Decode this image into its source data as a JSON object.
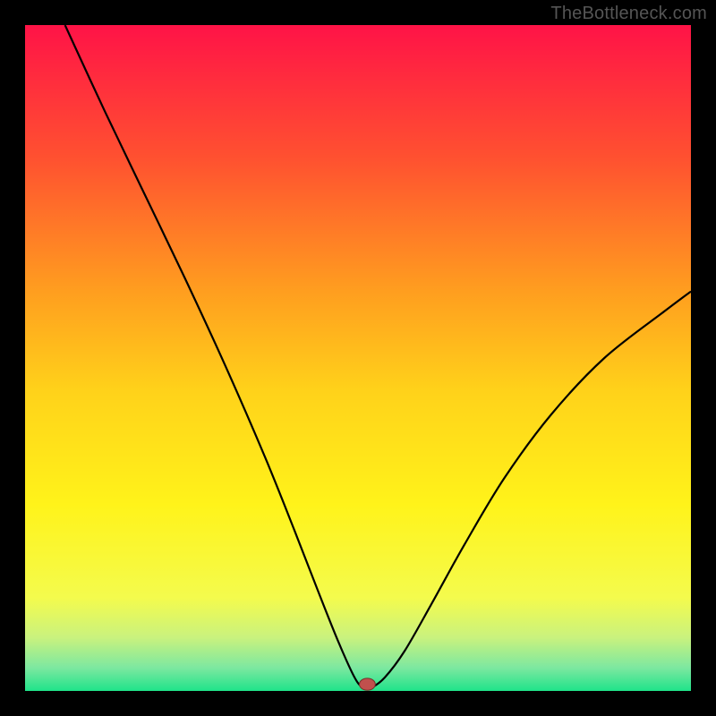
{
  "watermark": "TheBottleneck.com",
  "chart_data": {
    "type": "line",
    "title": "",
    "xlabel": "",
    "ylabel": "",
    "xlim": [
      0,
      1
    ],
    "ylim": [
      0,
      1
    ],
    "background_gradient": {
      "orientation": "vertical",
      "stops": [
        {
          "offset": 0.0,
          "color": "#ff1347"
        },
        {
          "offset": 0.2,
          "color": "#ff5130"
        },
        {
          "offset": 0.4,
          "color": "#ff9e1f"
        },
        {
          "offset": 0.55,
          "color": "#ffd21a"
        },
        {
          "offset": 0.72,
          "color": "#fff31a"
        },
        {
          "offset": 0.86,
          "color": "#f4fb4d"
        },
        {
          "offset": 0.92,
          "color": "#c9f27e"
        },
        {
          "offset": 0.965,
          "color": "#7de8a0"
        },
        {
          "offset": 1.0,
          "color": "#1fe38a"
        }
      ]
    },
    "series": [
      {
        "name": "bottleneck-curve",
        "color": "#000000",
        "x": [
          0.06,
          0.12,
          0.18,
          0.24,
          0.3,
          0.36,
          0.405,
          0.44,
          0.47,
          0.495,
          0.508,
          0.52,
          0.54,
          0.57,
          0.61,
          0.66,
          0.72,
          0.79,
          0.87,
          0.96,
          1.0
        ],
        "y": [
          1.0,
          0.87,
          0.745,
          0.62,
          0.49,
          0.352,
          0.24,
          0.15,
          0.075,
          0.02,
          0.005,
          0.005,
          0.02,
          0.06,
          0.13,
          0.22,
          0.32,
          0.415,
          0.5,
          0.57,
          0.6
        ]
      }
    ],
    "marker": {
      "name": "min-marker",
      "x": 0.514,
      "y": 0.01,
      "rx": 0.012,
      "ry": 0.009,
      "fill": "#c0504d",
      "stroke": "#7a2e2b"
    }
  }
}
